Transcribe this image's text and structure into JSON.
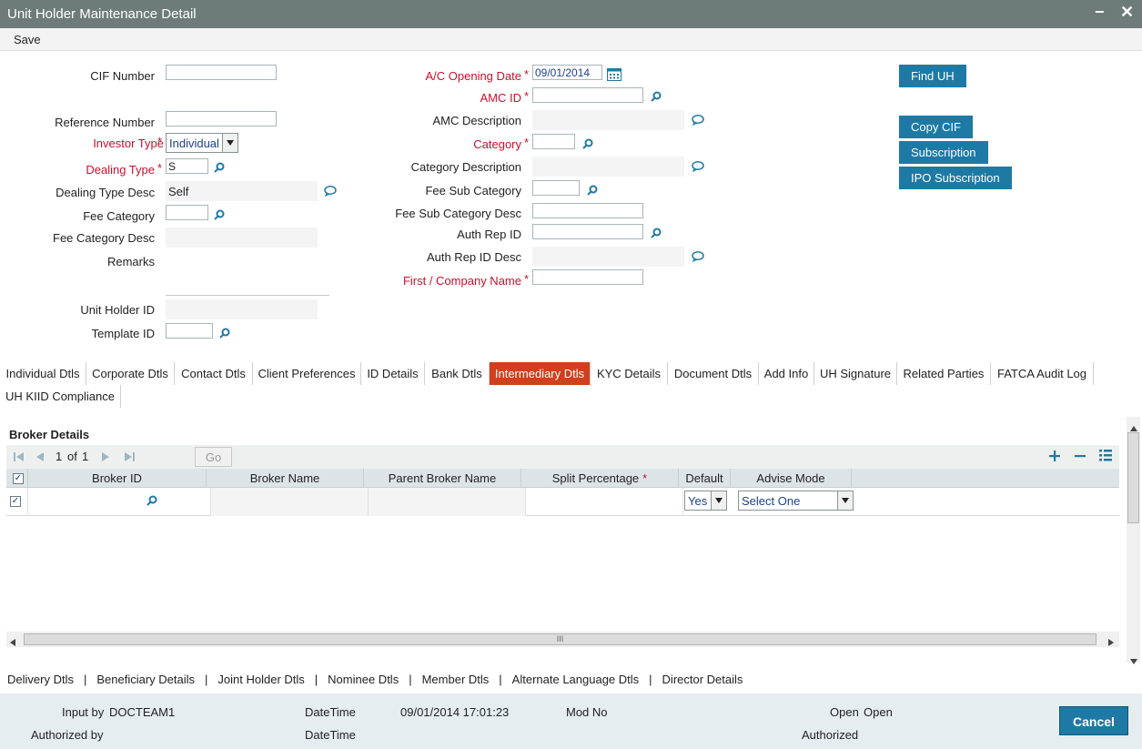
{
  "window": {
    "title": "Unit Holder Maintenance Detail",
    "minimize": "−",
    "close": "✕"
  },
  "menu": {
    "save": "Save"
  },
  "form": {
    "cif_number": {
      "label": "CIF Number",
      "value": ""
    },
    "reference_number": {
      "label": "Reference Number",
      "value": ""
    },
    "investor_type": {
      "label": "Investor Type",
      "value": "Individual"
    },
    "dealing_type": {
      "label": "Dealing Type",
      "value": "S"
    },
    "dealing_type_desc": {
      "label": "Dealing Type Desc",
      "value": "Self"
    },
    "fee_category": {
      "label": "Fee Category",
      "value": ""
    },
    "fee_category_desc": {
      "label": "Fee Category Desc",
      "value": ""
    },
    "remarks": {
      "label": "Remarks",
      "value": ""
    },
    "unit_holder_id": {
      "label": "Unit Holder ID",
      "value": ""
    },
    "template_id": {
      "label": "Template ID",
      "value": ""
    },
    "ac_opening_date": {
      "label": "A/C Opening Date",
      "value": "09/01/2014"
    },
    "amc_id": {
      "label": "AMC ID",
      "value": ""
    },
    "amc_description": {
      "label": "AMC Description",
      "value": ""
    },
    "category": {
      "label": "Category",
      "value": ""
    },
    "category_description": {
      "label": "Category Description",
      "value": ""
    },
    "fee_sub_category": {
      "label": "Fee Sub Category",
      "value": ""
    },
    "fee_sub_category_desc": {
      "label": "Fee Sub Category Desc",
      "value": ""
    },
    "auth_rep_id": {
      "label": "Auth Rep ID",
      "value": ""
    },
    "auth_rep_id_desc": {
      "label": "Auth Rep ID Desc",
      "value": ""
    },
    "first_company_name": {
      "label": "First / Company Name",
      "value": ""
    },
    "required_mark": "*"
  },
  "buttons": {
    "find_uh": "Find UH",
    "copy_cif": "Copy CIF",
    "subscription": "Subscription",
    "ipo_subscription": "IPO Subscription"
  },
  "tabs": [
    "Individual Dtls",
    "Corporate Dtls",
    "Contact Dtls",
    "Client Preferences",
    "ID Details",
    "Bank Dtls",
    "Intermediary Dtls",
    "KYC Details",
    "Document Dtls",
    "Add Info",
    "UH Signature",
    "Related Parties",
    "FATCA Audit Log",
    "UH KIID Compliance"
  ],
  "active_tab": "Intermediary Dtls",
  "broker": {
    "title": "Broker Details",
    "pager": {
      "current": "1",
      "of_label": "of",
      "total": "1",
      "go": "Go"
    },
    "columns": [
      "Broker ID",
      "Broker Name",
      "Parent Broker Name",
      "Split Percentage",
      "Default",
      "Advise Mode"
    ],
    "required_mark": "*",
    "rows": [
      {
        "broker_id": "",
        "broker_name": "",
        "parent_broker_name": "",
        "split_percentage": "",
        "default": "Yes",
        "advise_mode": "Select One"
      }
    ],
    "scroll_mark": "III"
  },
  "sub_links": [
    "Delivery Dtls",
    "Beneficiary Details",
    "Joint Holder Dtls",
    "Nominee Dtls",
    "Member Dtls",
    "Alternate Language Dtls",
    "Director Details"
  ],
  "link_separator": "|",
  "footer": {
    "input_by_label": "Input by",
    "input_by_value": "DOCTEAM1",
    "authorized_by_label": "Authorized by",
    "datetime_label": "DateTime",
    "datetime_value": "09/01/2014 17:01:23",
    "datetime2_label": "DateTime",
    "mod_no_label": "Mod No",
    "open_label": "Open",
    "open_value": "Open",
    "authorized_label": "Authorized",
    "cancel": "Cancel"
  },
  "colors": {
    "title_bar": "#6d7c78",
    "button": "#1e7aa5",
    "active_tab": "#d13f1c",
    "required": "#c8102e"
  }
}
